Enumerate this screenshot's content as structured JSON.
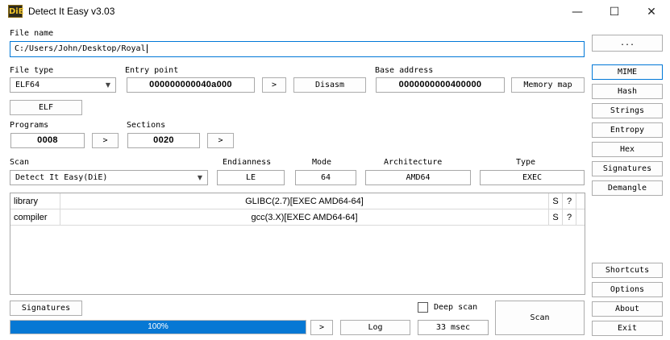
{
  "window": {
    "icon_text": "DiE",
    "title": "Detect It Easy v3.03",
    "minimize_glyph": "—",
    "maximize_glyph": "☐",
    "close_glyph": "✕"
  },
  "file": {
    "label": "File name",
    "path": "C:/Users/John/Desktop/Royal",
    "browse_label": "..."
  },
  "file_type": {
    "label": "File type",
    "value": "ELF64",
    "type_button": "ELF"
  },
  "entry_point": {
    "label": "Entry point",
    "value": "000000000040a000",
    "go_label": ">",
    "disasm_label": "Disasm"
  },
  "base_address": {
    "label": "Base address",
    "value": "0000000000400000",
    "memory_map_label": "Memory map"
  },
  "programs": {
    "label": "Programs",
    "value": "0008",
    "go_label": ">"
  },
  "sections": {
    "label": "Sections",
    "value": "0020",
    "go_label": ">"
  },
  "scan": {
    "label": "Scan",
    "engine": "Detect It Easy(DiE)",
    "endianness_label": "Endianness",
    "endianness": "LE",
    "mode_label": "Mode",
    "mode": "64",
    "architecture_label": "Architecture",
    "architecture": "AMD64",
    "type_label": "Type",
    "type": "EXEC"
  },
  "results": [
    {
      "kind": "library",
      "value": "GLIBC(2.7)[EXEC AMD64-64]",
      "s": "S",
      "q": "?"
    },
    {
      "kind": "compiler",
      "value": "gcc(3.X)[EXEC AMD64-64]",
      "s": "S",
      "q": "?"
    }
  ],
  "bottom": {
    "signatures_label": "Signatures",
    "progress_text": "100%",
    "progress_fraction": 1.0,
    "go_label": ">",
    "log_label": "Log",
    "deep_scan_label": "Deep scan",
    "deep_scan_checked": false,
    "elapsed": "33 msec",
    "scan_label": "Scan"
  },
  "side_buttons": {
    "mime": "MIME",
    "hash": "Hash",
    "strings": "Strings",
    "entropy": "Entropy",
    "hex": "Hex",
    "signatures": "Signatures",
    "demangle": "Demangle",
    "shortcuts": "Shortcuts",
    "options": "Options",
    "about": "About",
    "exit": "Exit"
  },
  "colors": {
    "accent_blue": "#0078d7",
    "progress_fill": "#0678d4",
    "icon_bg": "#2d2a1d",
    "icon_fg": "#f3c62a"
  }
}
